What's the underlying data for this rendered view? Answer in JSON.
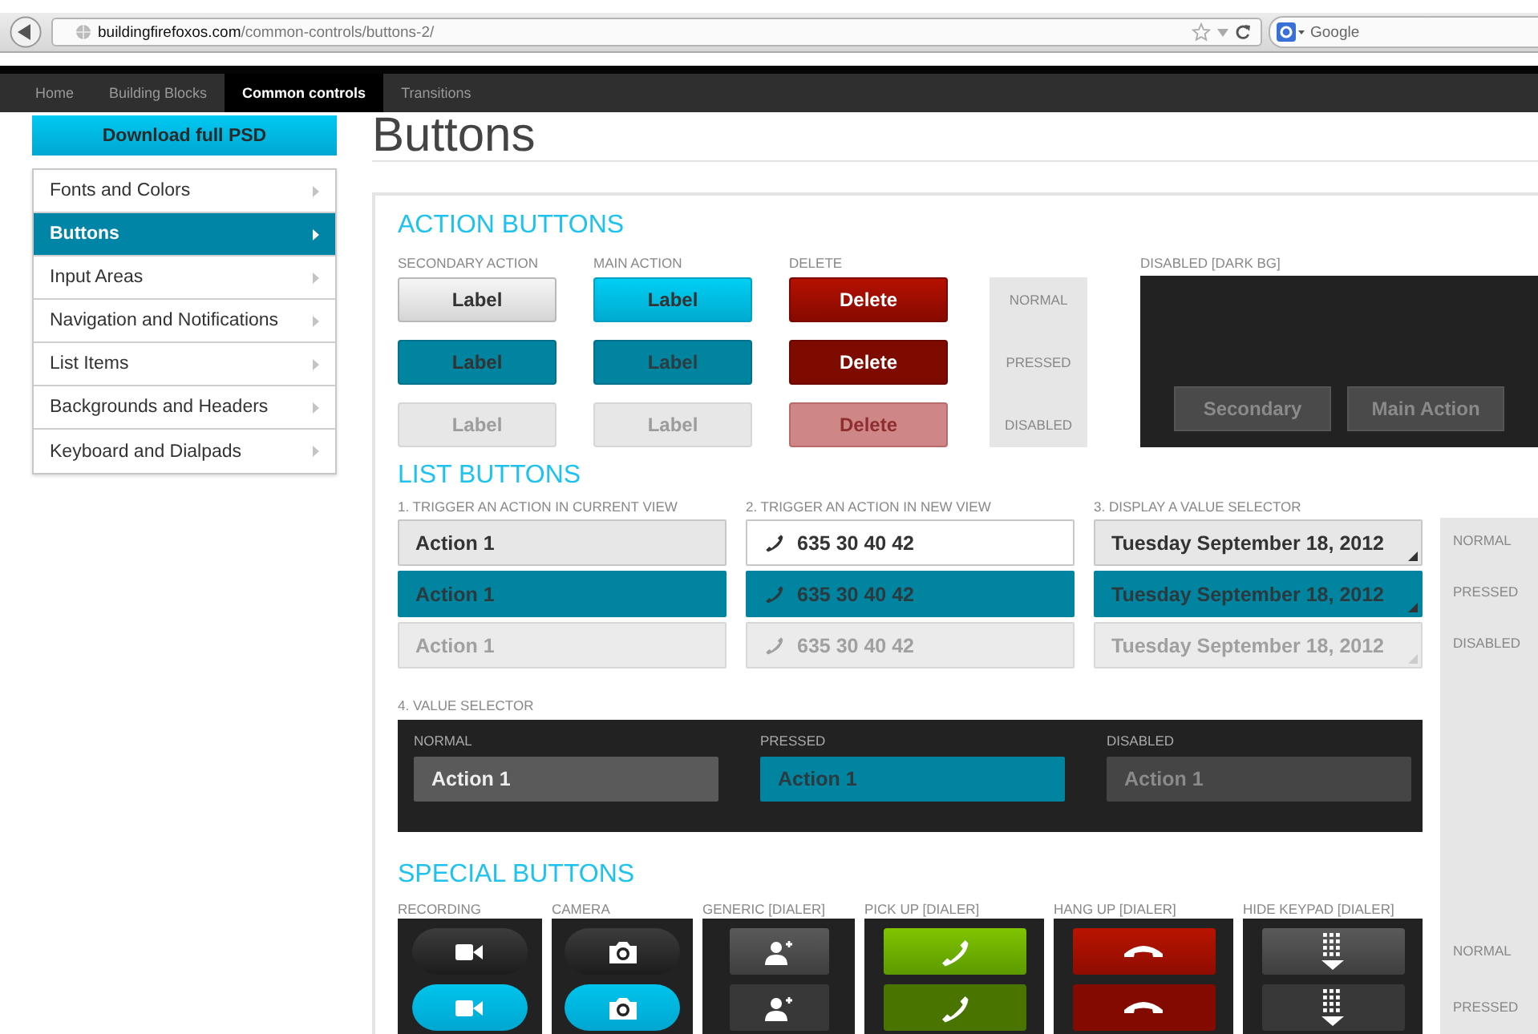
{
  "browser": {
    "url_host": "buildingfirefoxos.com",
    "url_path": "/common-controls/buttons-2/",
    "search_placeholder": "Google"
  },
  "nav": [
    {
      "label": "Home",
      "selected": false
    },
    {
      "label": "Building Blocks",
      "selected": false
    },
    {
      "label": "Common controls",
      "selected": true
    },
    {
      "label": "Transitions",
      "selected": false
    }
  ],
  "download_button": "Download full PSD",
  "sidebar": [
    {
      "label": "Fonts and Colors",
      "selected": false
    },
    {
      "label": "Buttons",
      "selected": true
    },
    {
      "label": "Input Areas",
      "selected": false
    },
    {
      "label": "Navigation and Notifications",
      "selected": false
    },
    {
      "label": "List Items",
      "selected": false
    },
    {
      "label": "Backgrounds and Headers",
      "selected": false
    },
    {
      "label": "Keyboard and Dialpads",
      "selected": false
    }
  ],
  "page_title": "Buttons",
  "action_buttons": {
    "title": "ACTION BUTTONS",
    "columns": [
      {
        "heading": "SECONDARY ACTION",
        "kind": "secondary",
        "buttons": [
          {
            "label": "Label",
            "pressed": false,
            "disabled": false
          },
          {
            "label": "Label",
            "pressed": true,
            "disabled": false
          },
          {
            "label": "Label",
            "pressed": false,
            "disabled": true
          }
        ]
      },
      {
        "heading": "MAIN ACTION",
        "kind": "main",
        "buttons": [
          {
            "label": "Label",
            "pressed": false,
            "disabled": false
          },
          {
            "label": "Label",
            "pressed": true,
            "disabled": false
          },
          {
            "label": "Label",
            "pressed": false,
            "disabled": true
          }
        ]
      },
      {
        "heading": "DELETE",
        "kind": "delete",
        "buttons": [
          {
            "label": "Delete",
            "pressed": false,
            "disabled": false
          },
          {
            "label": "Delete",
            "pressed": true,
            "disabled": false
          },
          {
            "label": "Delete",
            "pressed": false,
            "disabled": true
          }
        ]
      }
    ],
    "states": [
      "NORMAL",
      "PRESSED",
      "DISABLED"
    ],
    "dark": {
      "heading": "DISABLED [DARK BG]",
      "buttons": [
        "Secondary",
        "Main Action"
      ]
    }
  },
  "list_buttons": {
    "title": "LIST BUTTONS",
    "columns": [
      {
        "heading": "1. TRIGGER AN ACTION IN CURRENT VIEW",
        "kind": "plain",
        "buttons": [
          {
            "label": "Action 1",
            "pressed": false,
            "disabled": false
          },
          {
            "label": "Action 1",
            "pressed": true,
            "disabled": false
          },
          {
            "label": "Action 1",
            "pressed": false,
            "disabled": true
          }
        ]
      },
      {
        "heading": "2. TRIGGER AN ACTION IN NEW VIEW",
        "kind": "phone",
        "buttons": [
          {
            "label": "635 30 40 42",
            "pressed": false,
            "disabled": false
          },
          {
            "label": "635 30 40 42",
            "pressed": true,
            "disabled": false
          },
          {
            "label": "635 30 40 42",
            "pressed": false,
            "disabled": true
          }
        ]
      },
      {
        "heading": "3. DISPLAY A VALUE SELECTOR",
        "kind": "selector",
        "buttons": [
          {
            "label": "Tuesday September 18, 2012",
            "pressed": false,
            "disabled": false
          },
          {
            "label": "Tuesday September 18, 2012",
            "pressed": true,
            "disabled": false
          },
          {
            "label": "Tuesday September 18, 2012",
            "pressed": false,
            "disabled": true
          }
        ]
      }
    ],
    "states": [
      "NORMAL",
      "PRESSED",
      "DISABLED"
    ],
    "value_selector": {
      "heading": "4. VALUE SELECTOR",
      "items": [
        {
          "heading": "NORMAL",
          "label": "Action 1",
          "pressed": false,
          "disabled": false
        },
        {
          "heading": "PRESSED",
          "label": "Action 1",
          "pressed": true,
          "disabled": false
        },
        {
          "heading": "DISABLED",
          "label": "Action 1",
          "pressed": false,
          "disabled": true
        }
      ]
    }
  },
  "special_buttons": {
    "title": "SPECIAL BUTTONS",
    "columns": [
      {
        "heading": "RECORDING",
        "kind": "recording",
        "buttons": [
          {
            "pressed": false
          },
          {
            "pressed": true
          }
        ]
      },
      {
        "heading": "CAMERA",
        "kind": "camera",
        "buttons": [
          {
            "pressed": false
          },
          {
            "pressed": true
          }
        ]
      },
      {
        "heading": "GENERIC [DIALER]",
        "kind": "generic",
        "buttons": [
          {
            "pressed": false
          },
          {
            "pressed": true
          }
        ]
      },
      {
        "heading": "PICK UP [DIALER]",
        "kind": "pickup",
        "buttons": [
          {
            "pressed": false
          },
          {
            "pressed": true
          }
        ]
      },
      {
        "heading": "HANG UP [DIALER]",
        "kind": "hangup",
        "buttons": [
          {
            "pressed": false
          },
          {
            "pressed": true
          }
        ]
      },
      {
        "heading": "HIDE KEYPAD [DIALER]",
        "kind": "keypad",
        "buttons": [
          {
            "pressed": false
          },
          {
            "pressed": true
          }
        ]
      }
    ],
    "states": [
      "NORMAL",
      "PRESSED"
    ]
  }
}
